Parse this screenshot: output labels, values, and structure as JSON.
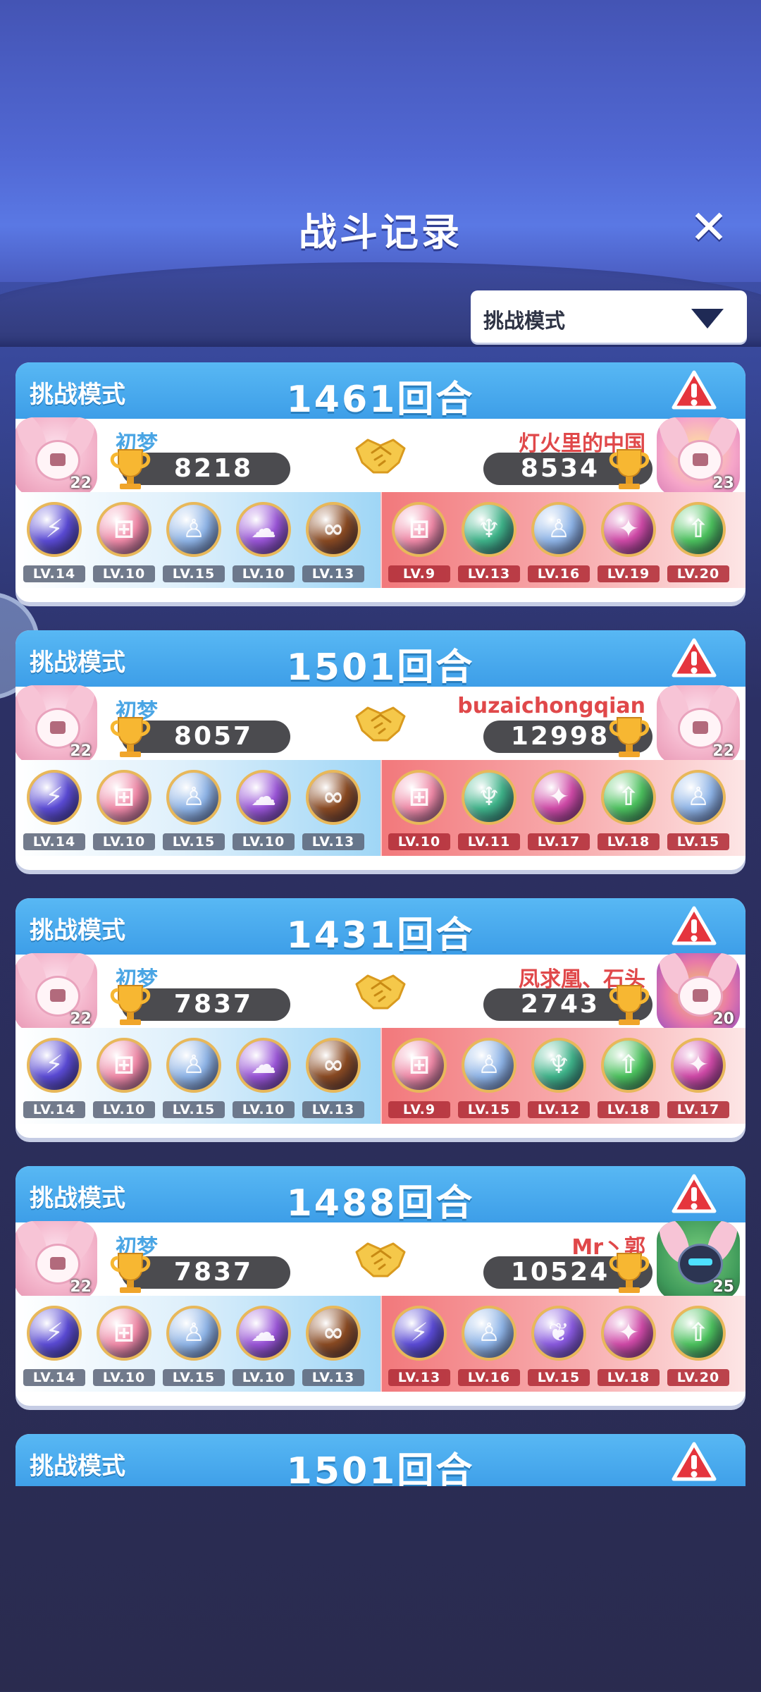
{
  "header": {
    "title": "战斗记录",
    "close_icon": "close-icon"
  },
  "filter": {
    "selected": "挑战模式",
    "arrow_icon": "triangle-down-icon"
  },
  "colors": {
    "header_blue": "#4a8fe8",
    "ally": "#4aa5e4",
    "enemy": "#e0484a"
  },
  "records": [
    {
      "mode": "挑战模式",
      "rounds": "1461回合",
      "left": {
        "name": "初梦",
        "score": "8218",
        "level": "22",
        "avatar": "pink-bunny"
      },
      "right": {
        "name": "灯火里的中国",
        "score": "8534",
        "level": "23",
        "avatar": "celebration"
      },
      "left_team": [
        {
          "lv": "LV.14",
          "color": "#5b4bd6",
          "glyph": "⚡"
        },
        {
          "lv": "LV.10",
          "color": "#f08aa8",
          "glyph": "⊞"
        },
        {
          "lv": "LV.15",
          "color": "#8fb5e8",
          "glyph": "♙"
        },
        {
          "lv": "LV.10",
          "color": "#9a55d8",
          "glyph": "☁"
        },
        {
          "lv": "LV.13",
          "color": "#8a4a22",
          "glyph": "∞"
        }
      ],
      "right_team": [
        {
          "lv": "LV.9",
          "color": "#f08aa8",
          "glyph": "⊞"
        },
        {
          "lv": "LV.13",
          "color": "#3fb48a",
          "glyph": "♆"
        },
        {
          "lv": "LV.16",
          "color": "#8fb5e8",
          "glyph": "♙"
        },
        {
          "lv": "LV.19",
          "color": "#d04aa8",
          "glyph": "✦"
        },
        {
          "lv": "LV.20",
          "color": "#4cc25e",
          "glyph": "⇧"
        }
      ]
    },
    {
      "mode": "挑战模式",
      "rounds": "1501回合",
      "left": {
        "name": "初梦",
        "score": "8057",
        "level": "22",
        "avatar": "pink-bunny"
      },
      "right": {
        "name": "buzaichongqian",
        "score": "12998",
        "level": "22",
        "avatar": "pink-bunny-alt"
      },
      "left_team": [
        {
          "lv": "LV.14",
          "color": "#5b4bd6",
          "glyph": "⚡"
        },
        {
          "lv": "LV.10",
          "color": "#f08aa8",
          "glyph": "⊞"
        },
        {
          "lv": "LV.15",
          "color": "#8fb5e8",
          "glyph": "♙"
        },
        {
          "lv": "LV.10",
          "color": "#9a55d8",
          "glyph": "☁"
        },
        {
          "lv": "LV.13",
          "color": "#8a4a22",
          "glyph": "∞"
        }
      ],
      "right_team": [
        {
          "lv": "LV.10",
          "color": "#f08aa8",
          "glyph": "⊞"
        },
        {
          "lv": "LV.11",
          "color": "#3fb48a",
          "glyph": "♆"
        },
        {
          "lv": "LV.17",
          "color": "#d04aa8",
          "glyph": "✦"
        },
        {
          "lv": "LV.18",
          "color": "#4cc25e",
          "glyph": "⇧"
        },
        {
          "lv": "LV.15",
          "color": "#8fb5e8",
          "glyph": "♙"
        }
      ]
    },
    {
      "mode": "挑战模式",
      "rounds": "1431回合",
      "left": {
        "name": "初梦",
        "score": "7837",
        "level": "22",
        "avatar": "pink-bunny"
      },
      "right": {
        "name": "凤求凰、石头",
        "score": "2743",
        "level": "20",
        "avatar": "phoenix"
      },
      "left_team": [
        {
          "lv": "LV.14",
          "color": "#5b4bd6",
          "glyph": "⚡"
        },
        {
          "lv": "LV.10",
          "color": "#f08aa8",
          "glyph": "⊞"
        },
        {
          "lv": "LV.15",
          "color": "#8fb5e8",
          "glyph": "♙"
        },
        {
          "lv": "LV.10",
          "color": "#9a55d8",
          "glyph": "☁"
        },
        {
          "lv": "LV.13",
          "color": "#8a4a22",
          "glyph": "∞"
        }
      ],
      "right_team": [
        {
          "lv": "LV.9",
          "color": "#f08aa8",
          "glyph": "⊞"
        },
        {
          "lv": "LV.15",
          "color": "#8fb5e8",
          "glyph": "♙"
        },
        {
          "lv": "LV.12",
          "color": "#3fb48a",
          "glyph": "♆"
        },
        {
          "lv": "LV.18",
          "color": "#4cc25e",
          "glyph": "⇧"
        },
        {
          "lv": "LV.17",
          "color": "#d04aa8",
          "glyph": "✦"
        }
      ]
    },
    {
      "mode": "挑战模式",
      "rounds": "1488回合",
      "left": {
        "name": "初梦",
        "score": "7837",
        "level": "22",
        "avatar": "pink-bunny"
      },
      "right": {
        "name": "Mr丶郭",
        "score": "10524",
        "level": "25",
        "avatar": "robot"
      },
      "left_team": [
        {
          "lv": "LV.14",
          "color": "#5b4bd6",
          "glyph": "⚡"
        },
        {
          "lv": "LV.10",
          "color": "#f08aa8",
          "glyph": "⊞"
        },
        {
          "lv": "LV.15",
          "color": "#8fb5e8",
          "glyph": "♙"
        },
        {
          "lv": "LV.10",
          "color": "#9a55d8",
          "glyph": "☁"
        },
        {
          "lv": "LV.13",
          "color": "#8a4a22",
          "glyph": "∞"
        }
      ],
      "right_team": [
        {
          "lv": "LV.13",
          "color": "#5b4bd6",
          "glyph": "⚡"
        },
        {
          "lv": "LV.16",
          "color": "#8fb5e8",
          "glyph": "♙"
        },
        {
          "lv": "LV.15",
          "color": "#8a5ae0",
          "glyph": "❦"
        },
        {
          "lv": "LV.18",
          "color": "#d04aa8",
          "glyph": "✦"
        },
        {
          "lv": "LV.20",
          "color": "#4cc25e",
          "glyph": "⇧"
        }
      ]
    }
  ],
  "partial_record": {
    "mode": "挑战模式",
    "rounds": "1501回合"
  }
}
